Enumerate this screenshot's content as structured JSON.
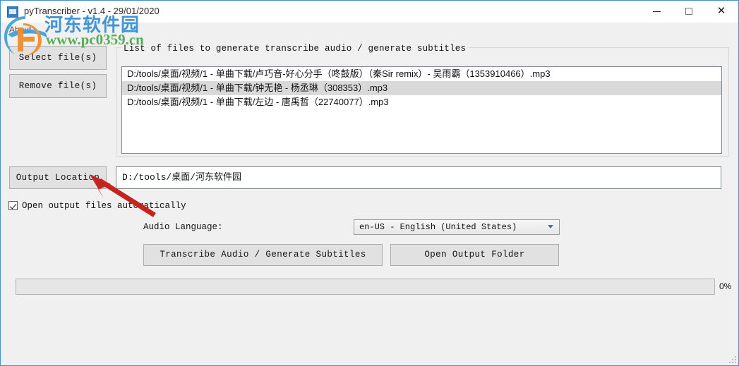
{
  "window": {
    "title": "pyTranscriber - v1.4 - 29/01/2020",
    "icon": "app-icon",
    "controls": {
      "minimize": "—",
      "maximize": "□",
      "close": "✕"
    },
    "border_color": "#4a90c4",
    "background_color": "#f0f0f0"
  },
  "menubar": {
    "items": [
      {
        "label": "About"
      }
    ]
  },
  "left_buttons": {
    "select_files": "Select file(s)",
    "remove_files": "Remove file(s)",
    "output_location": "Output Location"
  },
  "files_group": {
    "title": "List of files to generate transcribe audio / generate subtitles",
    "rows": [
      {
        "path": "D:/tools/桌面/视频/1 - 单曲下载/卢巧音-好心分手（咚鼓版）（秦Sir remix）- 吴雨霸（1353910466）.mp3",
        "selected": false
      },
      {
        "path": "D:/tools/桌面/视频/1 - 单曲下载/钟无艳 - 杨丞琳（308353）.mp3",
        "selected": true
      },
      {
        "path": "D:/tools/桌面/视频/1 - 单曲下载/左边 - 唐禹哲（22740077）.mp3",
        "selected": false
      }
    ]
  },
  "output": {
    "path_value": "D:/tools/桌面/河东软件园",
    "path_placeholder": "",
    "open_automatically_label": "Open output files automatically",
    "open_automatically_checked": true
  },
  "audio_language": {
    "label": "Audio Language:",
    "selected": "en-US - English (United States)"
  },
  "actions": {
    "transcribe": "Transcribe Audio / Generate Subtitles",
    "open_output_folder": "Open Output Folder"
  },
  "progress": {
    "percent_label": "0%",
    "percent_value": 0
  },
  "watermark": {
    "site_name_cn": "河东软件园",
    "site_url": "www.pc0359.cn",
    "cn_color": "#4195d6",
    "url_color": "#54b054"
  },
  "annotation": {
    "arrow_color": "#c4241c",
    "points_to": "output-location-button"
  }
}
